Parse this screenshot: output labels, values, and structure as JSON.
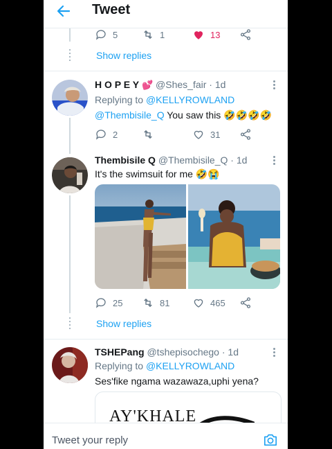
{
  "header": {
    "title": "Tweet"
  },
  "top_tweet": {
    "replies": "5",
    "retweets": "1",
    "likes": "13",
    "show_replies": "Show replies"
  },
  "tweet1": {
    "name": "H O P E Y",
    "name_emoji": "💕",
    "handle": "@Shes_fair",
    "time": "· 1d",
    "replying_label": "Replying to",
    "replying_to": "@KELLYROWLAND",
    "mention": "@Thembisile_Q",
    "text": " You saw this ",
    "emojis": "🤣🤣🤣🤣",
    "replies": "2",
    "retweets": "",
    "likes": "31"
  },
  "tweet2": {
    "name": "Thembisile Q",
    "handle": "@Thembisile_Q",
    "time": "· 1d",
    "text": "It's the swimsuit for me ",
    "emojis": "🤣😭",
    "replies": "25",
    "retweets": "81",
    "likes": "465",
    "show_replies": "Show replies"
  },
  "tweet3": {
    "name": "TSHEPang",
    "handle": "@tshepisochego",
    "time": "· 1d",
    "replying_label": "Replying to",
    "replying_to": "@KELLYROWLAND",
    "text": "Ses'fike ngama wazawaza,uphi yena?",
    "card_text": "AY'KHALE"
  },
  "composer": {
    "placeholder": "Tweet your reply"
  },
  "colors": {
    "accent": "#1da1f2",
    "like": "#e0245e",
    "muted": "#657786"
  }
}
